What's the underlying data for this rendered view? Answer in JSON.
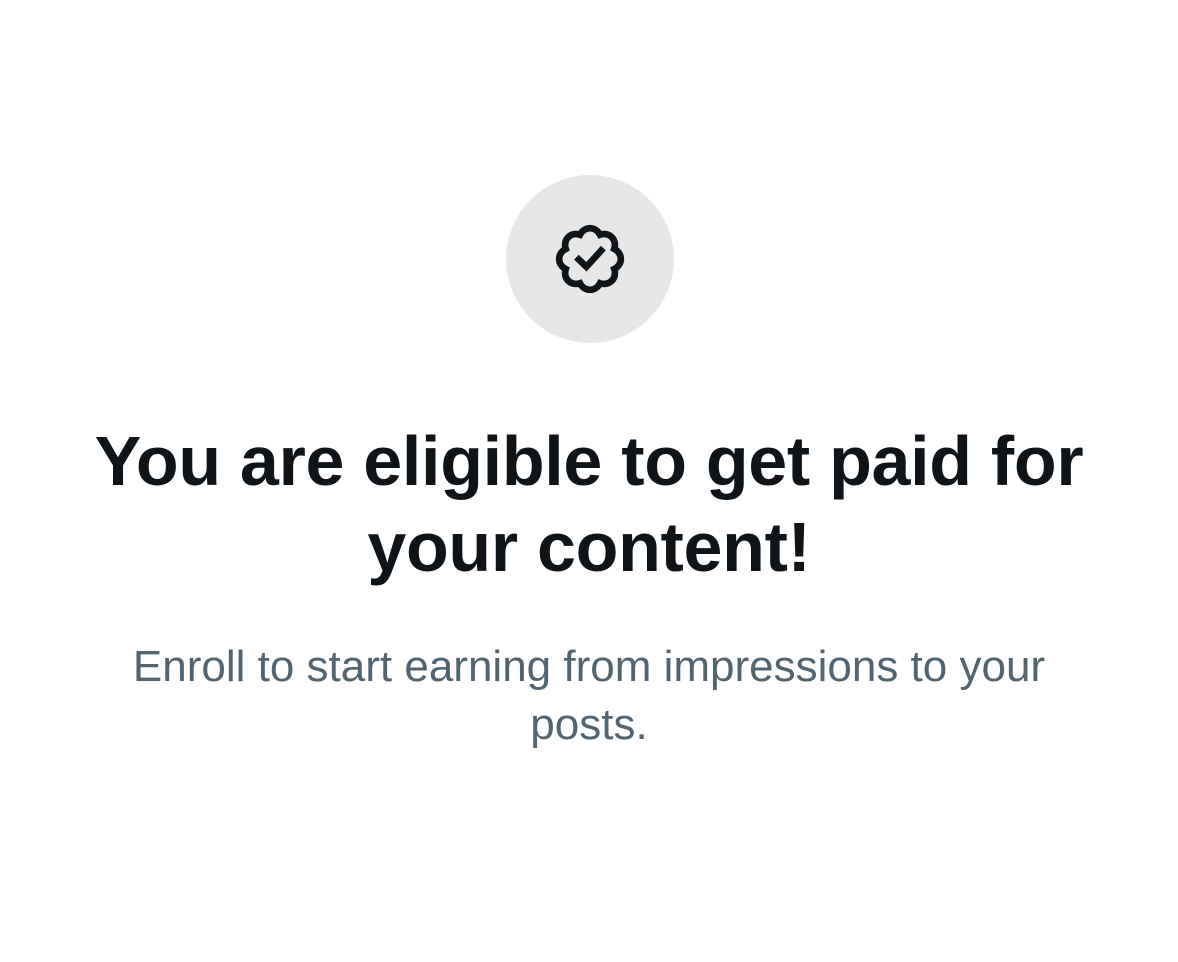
{
  "badge": {
    "icon": "verified-badge-check-icon",
    "circle_color": "#e7e7e7",
    "icon_color": "#0f1419"
  },
  "headline": "You are eligible to get paid for your content!",
  "subtext": "Enroll to start earning from impressions to your posts.",
  "colors": {
    "background": "#ffffff",
    "headline_text": "#0f1419",
    "secondary_text": "#536471"
  }
}
